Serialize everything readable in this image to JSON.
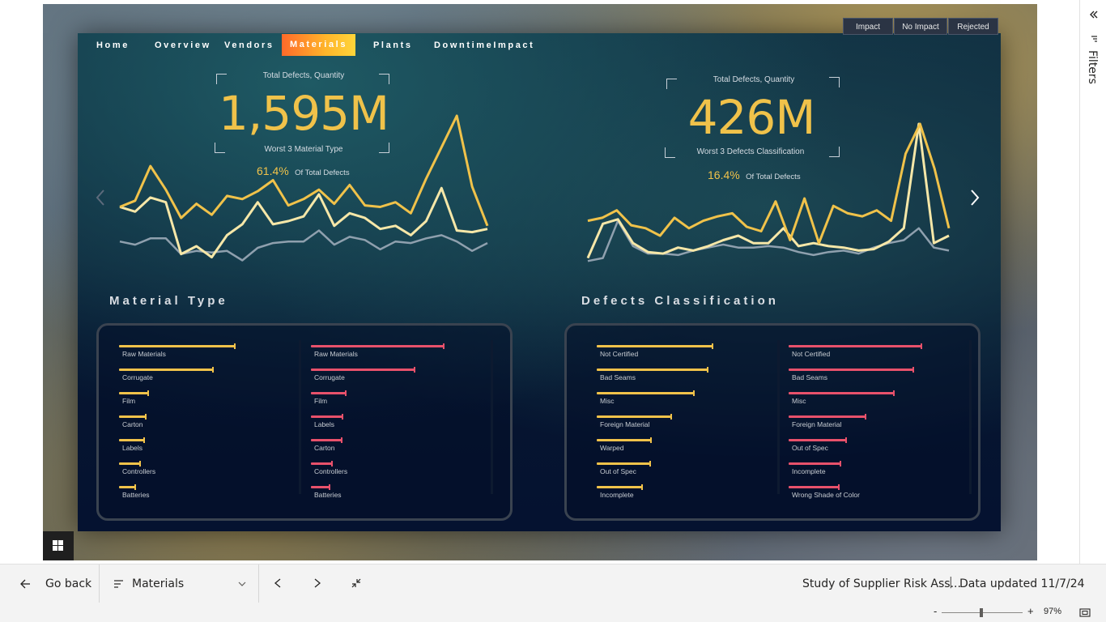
{
  "nav": {
    "tabs": [
      {
        "label": "Home"
      },
      {
        "label": "Overview"
      },
      {
        "label": "Vendors"
      },
      {
        "label": "Materials"
      },
      {
        "label": "Plants"
      },
      {
        "label": "DowntimeImpact"
      }
    ],
    "active_tab": "Materials"
  },
  "slicer": {
    "options": [
      "Impact",
      "No Impact",
      "Rejected"
    ]
  },
  "kpi_left": {
    "title": "Total Defects, Quantity",
    "value": "1,595M",
    "subtitle": "Worst 3 Material Type",
    "percent": "61.4%",
    "percent_label": "Of Total Defects"
  },
  "kpi_right": {
    "title": "Total Defects, Quantity",
    "value": "426M",
    "subtitle": "Worst 3 Defects Classification",
    "percent": "16.4%",
    "percent_label": "Of Total Defects"
  },
  "sections": {
    "left_title": "Material Type",
    "right_title": "Defects Classification"
  },
  "colors": {
    "yellow": "#f0c24a",
    "cream": "#f6e7a8",
    "grey": "#8fa0ae",
    "pink": "#e8516b"
  },
  "sparklines": {
    "left": {
      "yellow": [
        0.42,
        0.46,
        0.68,
        0.53,
        0.35,
        0.44,
        0.37,
        0.49,
        0.47,
        0.52,
        0.59,
        0.43,
        0.47,
        0.53,
        0.44,
        0.56,
        0.43,
        0.42,
        0.45,
        0.38,
        0.6,
        0.8,
        1.0,
        0.55,
        0.3
      ],
      "cream": [
        0.42,
        0.39,
        0.48,
        0.45,
        0.12,
        0.17,
        0.1,
        0.24,
        0.31,
        0.45,
        0.31,
        0.33,
        0.36,
        0.5,
        0.3,
        0.38,
        0.35,
        0.28,
        0.3,
        0.24,
        0.33,
        0.54,
        0.27,
        0.26,
        0.28
      ],
      "grey": [
        0.2,
        0.18,
        0.22,
        0.22,
        0.12,
        0.14,
        0.13,
        0.14,
        0.08,
        0.16,
        0.19,
        0.2,
        0.2,
        0.27,
        0.18,
        0.23,
        0.21,
        0.15,
        0.2,
        0.19,
        0.22,
        0.24,
        0.2,
        0.14,
        0.19
      ]
    },
    "right": {
      "yellow": [
        0.35,
        0.37,
        0.42,
        0.32,
        0.3,
        0.25,
        0.37,
        0.3,
        0.35,
        0.38,
        0.4,
        0.31,
        0.28,
        0.48,
        0.22,
        0.5,
        0.2,
        0.45,
        0.4,
        0.38,
        0.42,
        0.35,
        0.8,
        1.0,
        0.7,
        0.3
      ],
      "cream": [
        0.1,
        0.33,
        0.36,
        0.2,
        0.14,
        0.13,
        0.17,
        0.15,
        0.18,
        0.22,
        0.25,
        0.2,
        0.2,
        0.3,
        0.18,
        0.2,
        0.18,
        0.17,
        0.15,
        0.16,
        0.21,
        0.3,
        1.0,
        0.2,
        0.25
      ],
      "grey": [
        0.08,
        0.1,
        0.35,
        0.18,
        0.13,
        0.13,
        0.12,
        0.15,
        0.17,
        0.19,
        0.17,
        0.17,
        0.18,
        0.17,
        0.14,
        0.12,
        0.14,
        0.15,
        0.13,
        0.17,
        0.2,
        0.22,
        0.3,
        0.17,
        0.15
      ]
    }
  },
  "material_type": {
    "impact": [
      {
        "label": "Raw Materials",
        "value": 1.0
      },
      {
        "label": "Corrugate",
        "value": 0.81
      },
      {
        "label": "Film",
        "value": 0.25
      },
      {
        "label": "Carton",
        "value": 0.23
      },
      {
        "label": "Labels",
        "value": 0.22
      },
      {
        "label": "Controllers",
        "value": 0.18
      },
      {
        "label": "Batteries",
        "value": 0.14
      }
    ],
    "no_impact": [
      {
        "label": "Raw Materials",
        "value": 1.0
      },
      {
        "label": "Corrugate",
        "value": 0.78
      },
      {
        "label": "Film",
        "value": 0.26
      },
      {
        "label": "Labels",
        "value": 0.24
      },
      {
        "label": "Carton",
        "value": 0.23
      },
      {
        "label": "Controllers",
        "value": 0.16
      },
      {
        "label": "Batteries",
        "value": 0.14
      }
    ]
  },
  "defects_classification": {
    "impact": [
      {
        "label": "Not Certified",
        "value": 1.0
      },
      {
        "label": "Bad Seams",
        "value": 0.96
      },
      {
        "label": "Misc",
        "value": 0.84
      },
      {
        "label": "Foreign Material",
        "value": 0.64
      },
      {
        "label": "Warped",
        "value": 0.47
      },
      {
        "label": "Out of Spec",
        "value": 0.46
      },
      {
        "label": "Incomplete",
        "value": 0.39
      }
    ],
    "no_impact": [
      {
        "label": "Not Certified",
        "value": 1.0
      },
      {
        "label": "Bad Seams",
        "value": 0.94
      },
      {
        "label": "Misc",
        "value": 0.79
      },
      {
        "label": "Foreign Material",
        "value": 0.58
      },
      {
        "label": "Out of Spec",
        "value": 0.43
      },
      {
        "label": "Incomplete",
        "value": 0.39
      },
      {
        "label": "Wrong Shade of Color",
        "value": 0.38
      }
    ]
  },
  "bottom_bar": {
    "go_back": "Go back",
    "page_selector": "Materials",
    "report_name": "Study of Supplier Risk Ass...",
    "separator": "|",
    "data_updated": "Data updated 11/7/24"
  },
  "zoom": {
    "minus": "-",
    "plus": "+",
    "level": "97%"
  },
  "filters_pane": {
    "label": "Filters"
  },
  "icons": {
    "back": "arrow-left-icon",
    "pages": "page-list-icon",
    "dropdown": "chevron-down-icon",
    "prev": "chevron-left-icon",
    "next": "chevron-right-icon",
    "exit_fullscreen": "collapse-icon",
    "windows": "windows-icon",
    "fit": "fit-to-page-icon",
    "collapse_pane": "double-chevron-icon",
    "filter": "filter-icon"
  }
}
